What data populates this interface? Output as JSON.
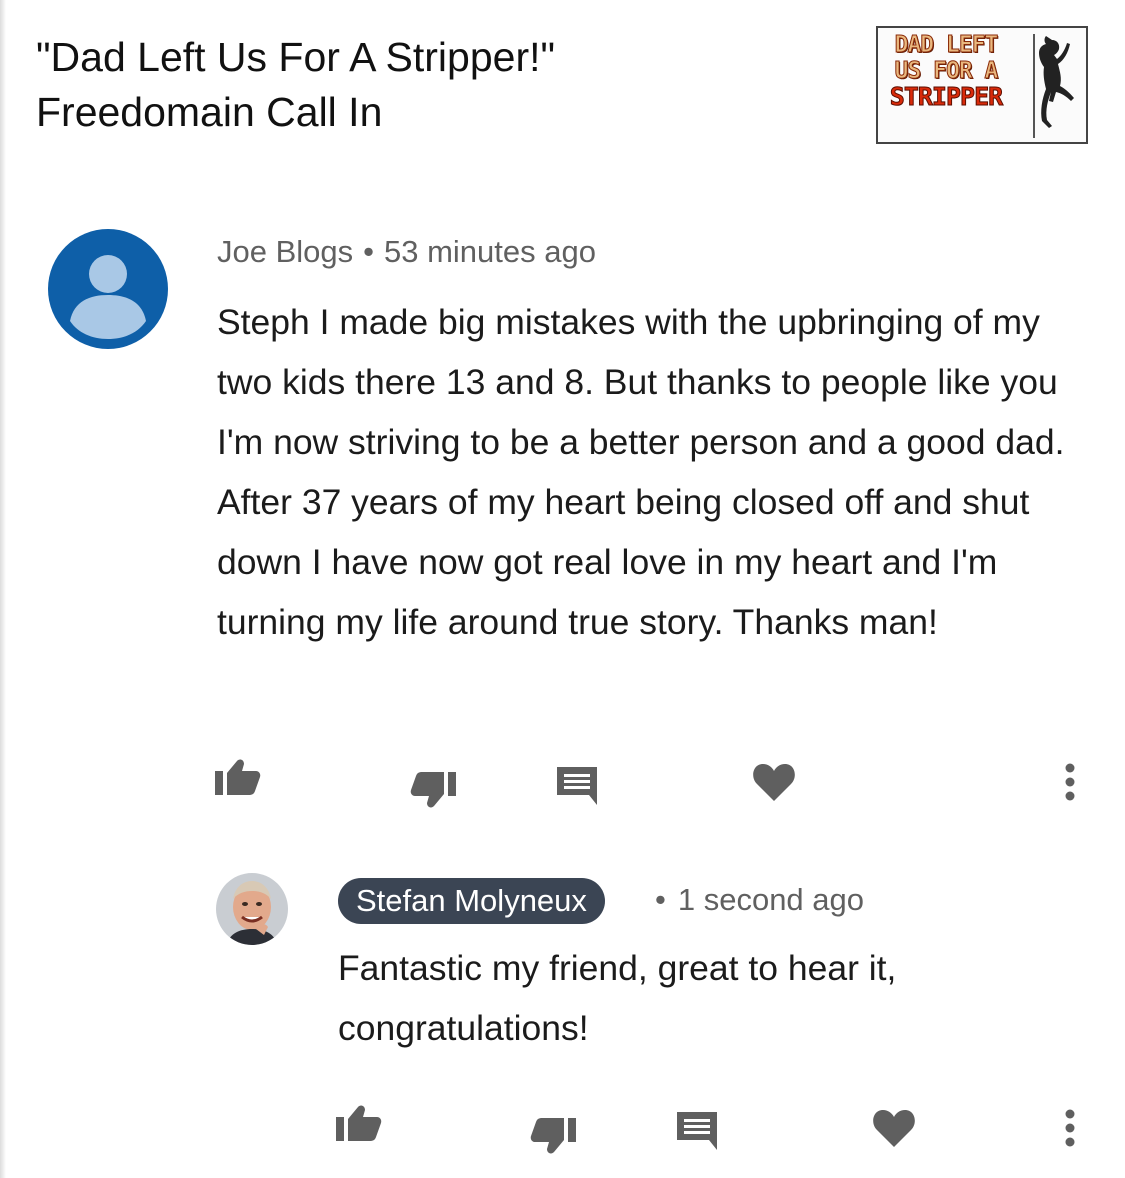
{
  "video": {
    "title_line1": "\"Dad Left Us For A Stripper!\"",
    "title_line2": "Freedomain Call In",
    "thumbnail": {
      "line1": "DAD LEFT",
      "line2": "US FOR A",
      "line3": "STRIPPER"
    }
  },
  "comment": {
    "author": "Joe Blogs",
    "separator": "•",
    "time": "53 minutes ago",
    "avatar_icon": "default-user-icon",
    "avatar_color": "#0e5fa8",
    "text": "Steph I made big mistakes with the upbringing of my two kids there 13 and 8. But thanks to people like you I'm now striving to be a better person and a good dad. After 37 years of my heart being closed off and shut down I have now got real love in my heart and I'm turning my life around true story. Thanks man!",
    "actions": [
      "thumb-up-icon",
      "thumb-down-icon",
      "reply-icon",
      "heart-icon",
      "more-vert-icon"
    ]
  },
  "reply": {
    "author": "Stefan Molyneux",
    "author_chip_color": "#3b4554",
    "separator": "•",
    "time": "1 second ago",
    "text": "Fantastic my friend, great to hear it, congratulations!",
    "actions": [
      "thumb-up-icon",
      "thumb-down-icon",
      "reply-icon",
      "heart-icon",
      "more-vert-icon"
    ]
  },
  "colors": {
    "icon_gray": "#606060",
    "meta_text": "#606060",
    "body_text": "#1b1b1b"
  }
}
